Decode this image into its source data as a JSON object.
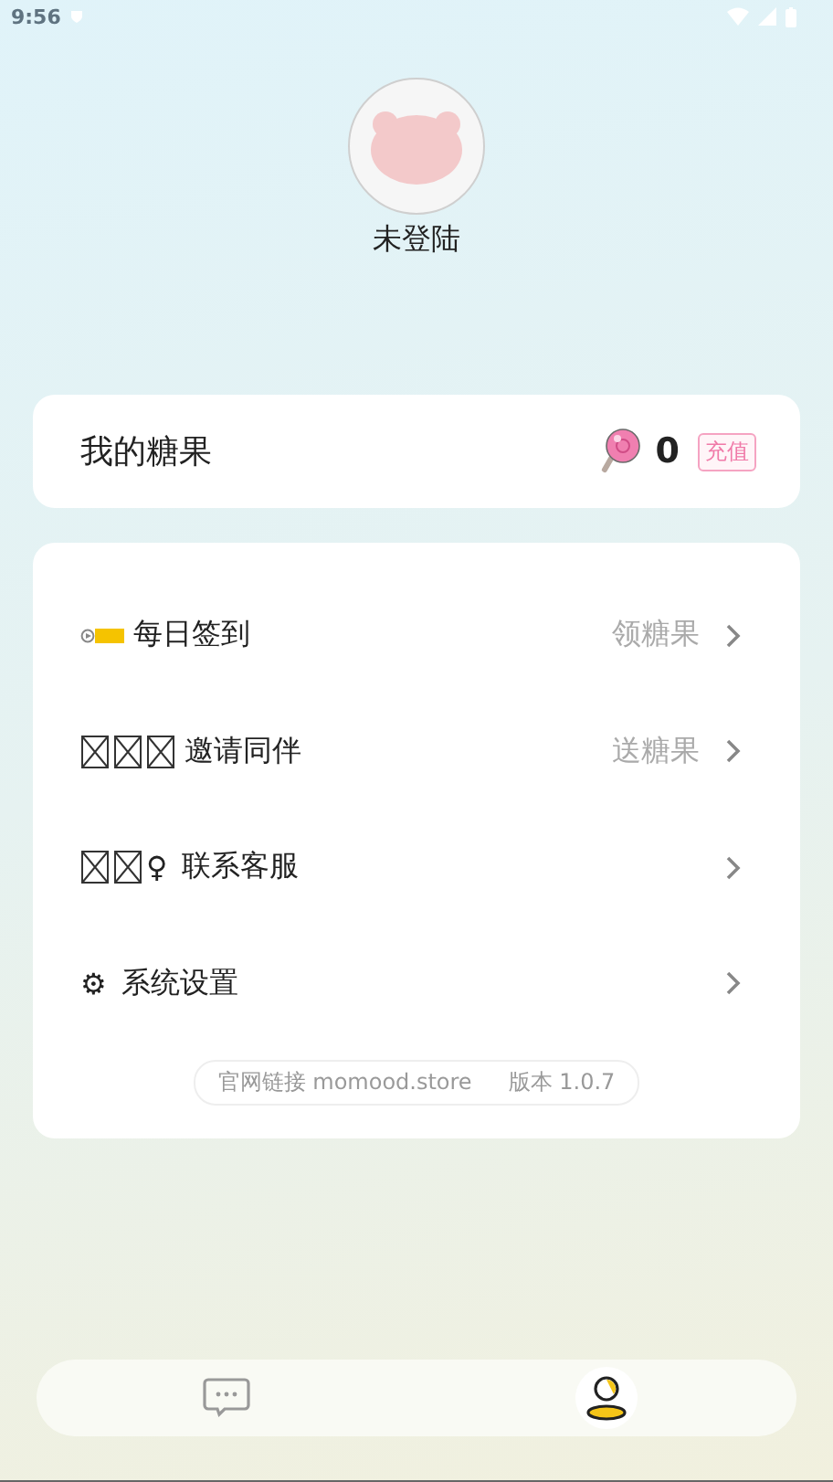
{
  "status_bar": {
    "time": "9:56"
  },
  "profile": {
    "name": "未登陆"
  },
  "candy": {
    "label": "我的糖果",
    "count": "0",
    "recharge": "充值"
  },
  "menu": [
    {
      "label": "每日签到",
      "hint": "领糖果"
    },
    {
      "label": "邀请同伴",
      "hint": "送糖果"
    },
    {
      "glyph": "♀",
      "label": "联系客服"
    },
    {
      "glyph": "⚙",
      "label": "系统设置"
    }
  ],
  "footer": {
    "link": "官网链接 momood.store",
    "version": "版本 1.0.7"
  },
  "nav": [
    {
      "selected": false
    },
    {
      "selected": true
    }
  ]
}
